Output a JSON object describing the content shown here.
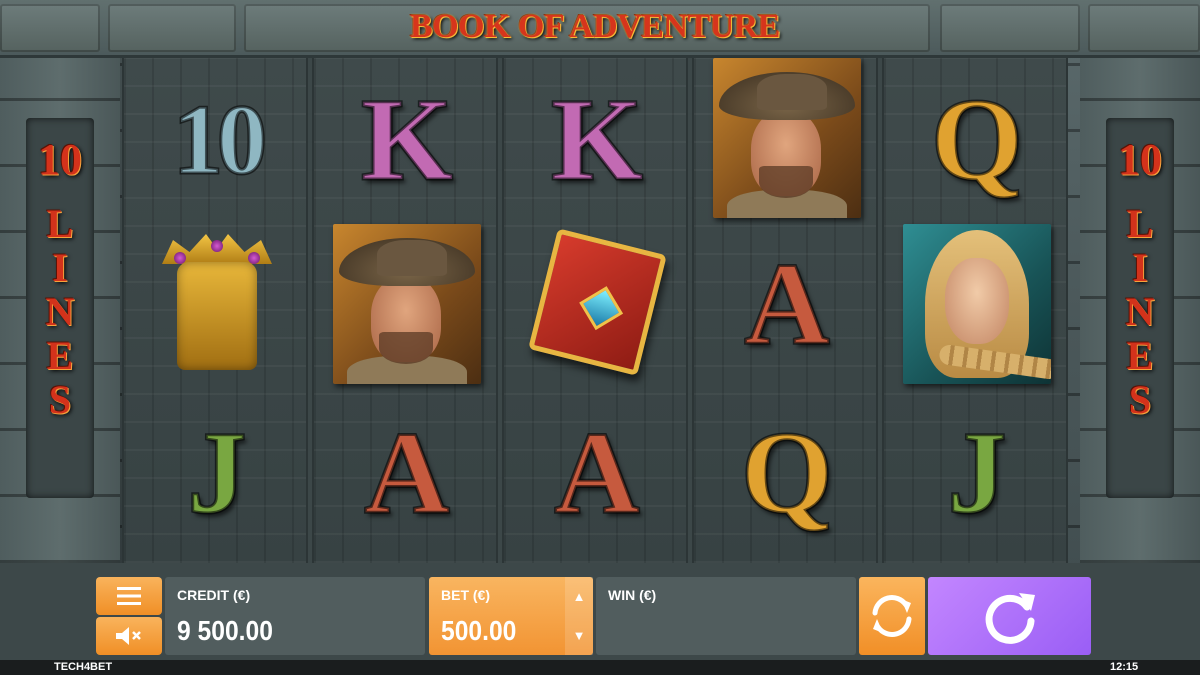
{
  "game": {
    "title": "BOOK OF ADVENTURE",
    "lines_label_left": {
      "number": "10",
      "word": [
        "L",
        "I",
        "N",
        "E",
        "S"
      ]
    },
    "lines_label_right": {
      "number": "10",
      "word": [
        "L",
        "I",
        "N",
        "E",
        "S"
      ]
    }
  },
  "reels": [
    [
      "10",
      "idol",
      "J"
    ],
    [
      "K",
      "adventurer",
      "A"
    ],
    [
      "K",
      "book",
      "A"
    ],
    [
      "adventurer",
      "A",
      "Q"
    ],
    [
      "Q",
      "heroine",
      "J"
    ]
  ],
  "symbol_icons": {
    "idol": "golden-idol-icon",
    "adventurer": "adventurer-portrait-icon",
    "heroine": "heroine-portrait-icon",
    "book": "book-of-adventure-icon"
  },
  "controls": {
    "menu_icon": "hamburger-menu-icon",
    "sound_icon": "speaker-muted-icon",
    "credit": {
      "label": "CREDIT (€)",
      "value": "9 500.00"
    },
    "bet": {
      "label": "BET (€)",
      "value": "500.00"
    },
    "win": {
      "label": "WIN (€)",
      "value": ""
    },
    "autoplay_icon": "autoplay-arrows-icon",
    "spin_icon": "spin-arrow-icon"
  },
  "footer": {
    "brand": "TECH4BET",
    "time": "12:15"
  },
  "colors": {
    "accent_orange": "#f29433",
    "spin_purple": "#a86bf8",
    "title_red": "#d6351c",
    "stone": "#4a5759"
  }
}
